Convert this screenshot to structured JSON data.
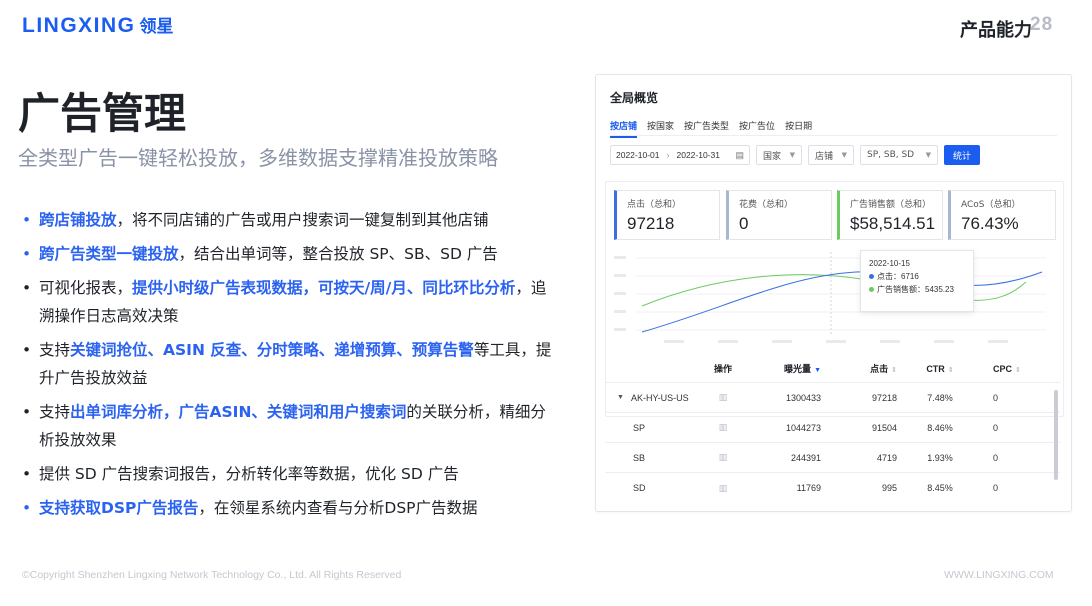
{
  "brand": {
    "en": "LINGXING",
    "cn": "领星"
  },
  "header": {
    "section": "产品能力",
    "page": "28"
  },
  "title": "广告管理",
  "subtitle": "全类型广告一键轻松投放，多维数据支撑精准投放策略",
  "bullets": [
    {
      "hl": "跨店铺投放",
      "rest": "，将不同店铺的广告或用户搜索词一键复制到其他店铺"
    },
    {
      "hl": "跨广告类型一键投放",
      "rest": "，结合出单词等，整合投放 SP、SB、SD 广告"
    },
    {
      "pre": "可视化报表，",
      "hl": "提供小时级广告表现数据，可按天/周/月、同比环比分析",
      "rest": "，追溯操作日志高效决策"
    },
    {
      "pre": "支持",
      "hl": "关键词抢位、ASIN 反查、分时策略、递增预算、预算告警",
      "rest": "等工具，提升广告投放效益"
    },
    {
      "pre": "支持",
      "hl": "出单词库分析，广告ASIN、关键词和用户搜索词",
      "rest": "的关联分析，精细分析投放效果"
    },
    {
      "plain": "提供 SD 广告搜索词报告，分析转化率等数据，优化 SD 广告"
    },
    {
      "hl": "支持获取DSP广告报告",
      "rest": "，在领星系统内查看与分析DSP广告数据"
    }
  ],
  "footer": {
    "copyright": "©Copyright Shenzhen Lingxing Network Technology Co., Ltd. All Rights Reserved",
    "url": "WWW.LINGXING.COM"
  },
  "panel": {
    "title": "全局概览",
    "tabs": [
      "按店铺",
      "按国家",
      "按广告类型",
      "按广告位",
      "按日期"
    ],
    "filters": {
      "date_start": "2022-10-01",
      "date_end": "2022-10-31",
      "country": "国家",
      "shop": "店铺",
      "ad_type": "SP, SB, SD",
      "submit": "统计"
    },
    "metrics": [
      {
        "label": "点击（总和）",
        "value": "97218",
        "color": "#3b6fe0"
      },
      {
        "label": "花费（总和）",
        "value": "0",
        "color": "#a9b6cf"
      },
      {
        "label": "广告销售额（总和）",
        "value": "$58,514.51",
        "color": "#6ccb5f"
      },
      {
        "label": "ACoS（总和）",
        "value": "76.43%",
        "color": "#a9b6cf"
      }
    ],
    "tooltip": {
      "date": "2022-10-15",
      "clicks_label": "点击：",
      "clicks_value": "6716",
      "sales_label": "广告销售额：",
      "sales_value": "5435.23"
    },
    "table": {
      "headers": {
        "op": "操作",
        "impressions": "曝光量",
        "clicks": "点击",
        "ctr": "CTR",
        "cpc": "CPC"
      },
      "rows": [
        {
          "name": "AK-HY-US-US",
          "impressions": "1300433",
          "clicks": "97218",
          "ctr": "7.48%",
          "cpc": "0"
        },
        {
          "name": "SP",
          "impressions": "1044273",
          "clicks": "91504",
          "ctr": "8.46%",
          "cpc": "0"
        },
        {
          "name": "SB",
          "impressions": "244391",
          "clicks": "4719",
          "ctr": "1.93%",
          "cpc": "0"
        },
        {
          "name": "SD",
          "impressions": "11769",
          "clicks": "995",
          "ctr": "8.45%",
          "cpc": "0"
        }
      ]
    }
  },
  "colors": {
    "accent": "#1a5df0",
    "line_blue": "#3b6fe0",
    "line_green": "#6ccb5f"
  }
}
